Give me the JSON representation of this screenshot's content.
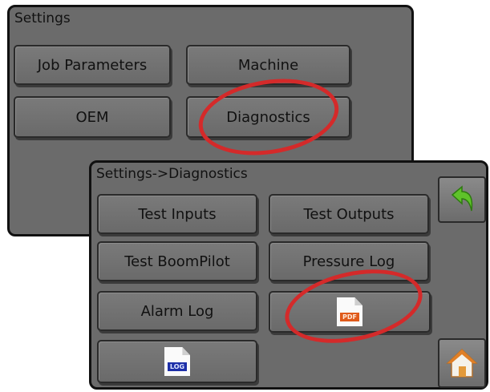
{
  "settings_screen": {
    "title": "Settings",
    "buttons": {
      "job_parameters": "Job Parameters",
      "machine": "Machine",
      "oem": "OEM",
      "diagnostics": "Diagnostics"
    }
  },
  "diagnostics_screen": {
    "title": "Settings->Diagnostics",
    "buttons": {
      "test_inputs": "Test Inputs",
      "test_outputs": "Test Outputs",
      "test_boompilot": "Test BoomPilot",
      "pressure_log": "Pressure Log",
      "alarm_log": "Alarm Log"
    },
    "file_buttons": {
      "pdf": {
        "icon": "pdf-file-icon",
        "tag": "PDF"
      },
      "log": {
        "icon": "log-file-icon",
        "tag": "LOG"
      }
    },
    "side_buttons": {
      "back": {
        "icon": "back-arrow-icon"
      },
      "home": {
        "icon": "home-icon"
      }
    }
  },
  "colors": {
    "panel_bg": "#6b6b6b",
    "button_bg": "#747474",
    "highlight_ellipse": "#d42a2a",
    "back_arrow": "#5fc22a",
    "home_roof": "#e07f26"
  }
}
